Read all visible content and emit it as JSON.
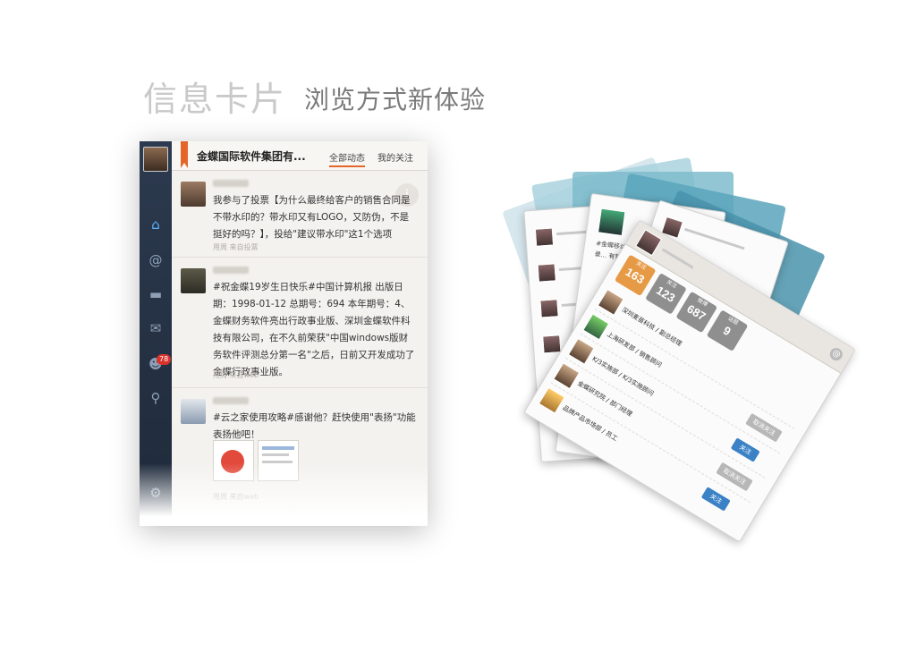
{
  "heading": {
    "title": "信息卡片",
    "subtitle": "浏览方式新体验"
  },
  "app": {
    "group_title": "金蝶国际软件集团有...",
    "tabs": [
      "全部动态",
      "我的关注"
    ],
    "rail_badge": "78",
    "rail_icons": [
      "home-icon",
      "at-icon",
      "chat-icon",
      "mail-icon",
      "people-icon",
      "search-icon",
      "gear-icon"
    ],
    "posts": [
      {
        "text": "我参与了投票【为什么最终给客户的销售合同是不带水印的？带水印又有LOGO，又防伪，不是挺好的吗？】，投给\"建议带水印\"这1个选项",
        "meta": "用周  来自投票"
      },
      {
        "text": "#祝金蝶19岁生日快乐#中国计算机报 出版日期：1998-01-12  总期号：694  本年期号：4、金蝶财务软件亮出行政事业版、深圳金蝶软件科技有限公司，在不久前荣获\"中国windows版财务软件评测总分第一名\"之后，日前又开发成功了金蝶行政事业版。",
        "meta": "用周  来自web"
      },
      {
        "text": "#云之家使用攻略#感谢他？赶快使用\"表扬\"功能表扬他吧！",
        "meta": "用周  来自web"
      }
    ]
  },
  "cards": {
    "stats": [
      {
        "label": "关注",
        "value": "163"
      },
      {
        "label": "关注",
        "value": "123"
      },
      {
        "label": "微博",
        "value": "687"
      },
      {
        "label": "话题",
        "value": "9"
      }
    ],
    "rows": [
      {
        "text": "深圳麦苗科技 / 副总经理"
      },
      {
        "text": "上海研发部 / 销售顾问"
      },
      {
        "text": "K/3实施部 / K/3实施顾问"
      },
      {
        "text": "金蝶研究院 / 部门经理"
      },
      {
        "text": "品牌产品市场部 / 员工"
      }
    ],
    "button_follow": "关注",
    "button_unfollow": "取消关注",
    "back_card_text": "#金蝶移动... EAS通讯录... 有管理... 钉扩..."
  },
  "colors": {
    "accent": "#e4652a",
    "rail_bg": "#2c3a4f",
    "fan_teal": "#4f9fb8",
    "follow_blue": "#3a81c6",
    "stat_orange": "#e69a45"
  }
}
